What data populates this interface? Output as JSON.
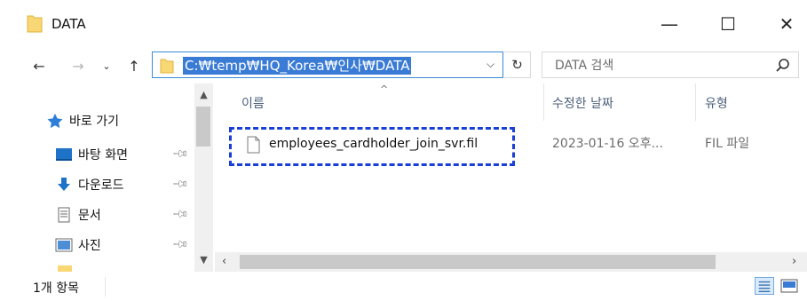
{
  "window": {
    "title": "DATA"
  },
  "window_controls": {
    "minimize": "—",
    "maximize": "☐",
    "close": "✕"
  },
  "toolbar": {
    "back": "←",
    "forward": "→",
    "recent": "⌄",
    "up": "↑",
    "address_path": "C:\\temp\\HQ_Korea\\인사\\DATA",
    "address_display": "C:₩temp₩HQ_Korea₩인사₩DATA",
    "refresh": "↻",
    "search_placeholder": "DATA 검색"
  },
  "navigation": {
    "items": [
      {
        "label": "바로 가기",
        "icon": "star-icon",
        "pinned": false
      },
      {
        "label": "바탕 화면",
        "icon": "desktop-icon",
        "pinned": true
      },
      {
        "label": "다운로드",
        "icon": "download-icon",
        "pinned": true
      },
      {
        "label": "문서",
        "icon": "documents-icon",
        "pinned": true
      },
      {
        "label": "사진",
        "icon": "pictures-icon",
        "pinned": true
      }
    ]
  },
  "file_list": {
    "columns": [
      "이름",
      "수정한 날짜",
      "유형"
    ],
    "sort_indicator": "^",
    "files": [
      {
        "name": "employees_cardholder_join_svr.fil",
        "modified": "2023-01-16 오후...",
        "type": "FIL 파일"
      }
    ]
  },
  "status_bar": {
    "item_count": "1개 항목"
  },
  "colors": {
    "selection": "#3a7bd5",
    "highlight_border": "#1a3ed6",
    "folder": "#f8d775",
    "column_header": "#4c607a"
  }
}
